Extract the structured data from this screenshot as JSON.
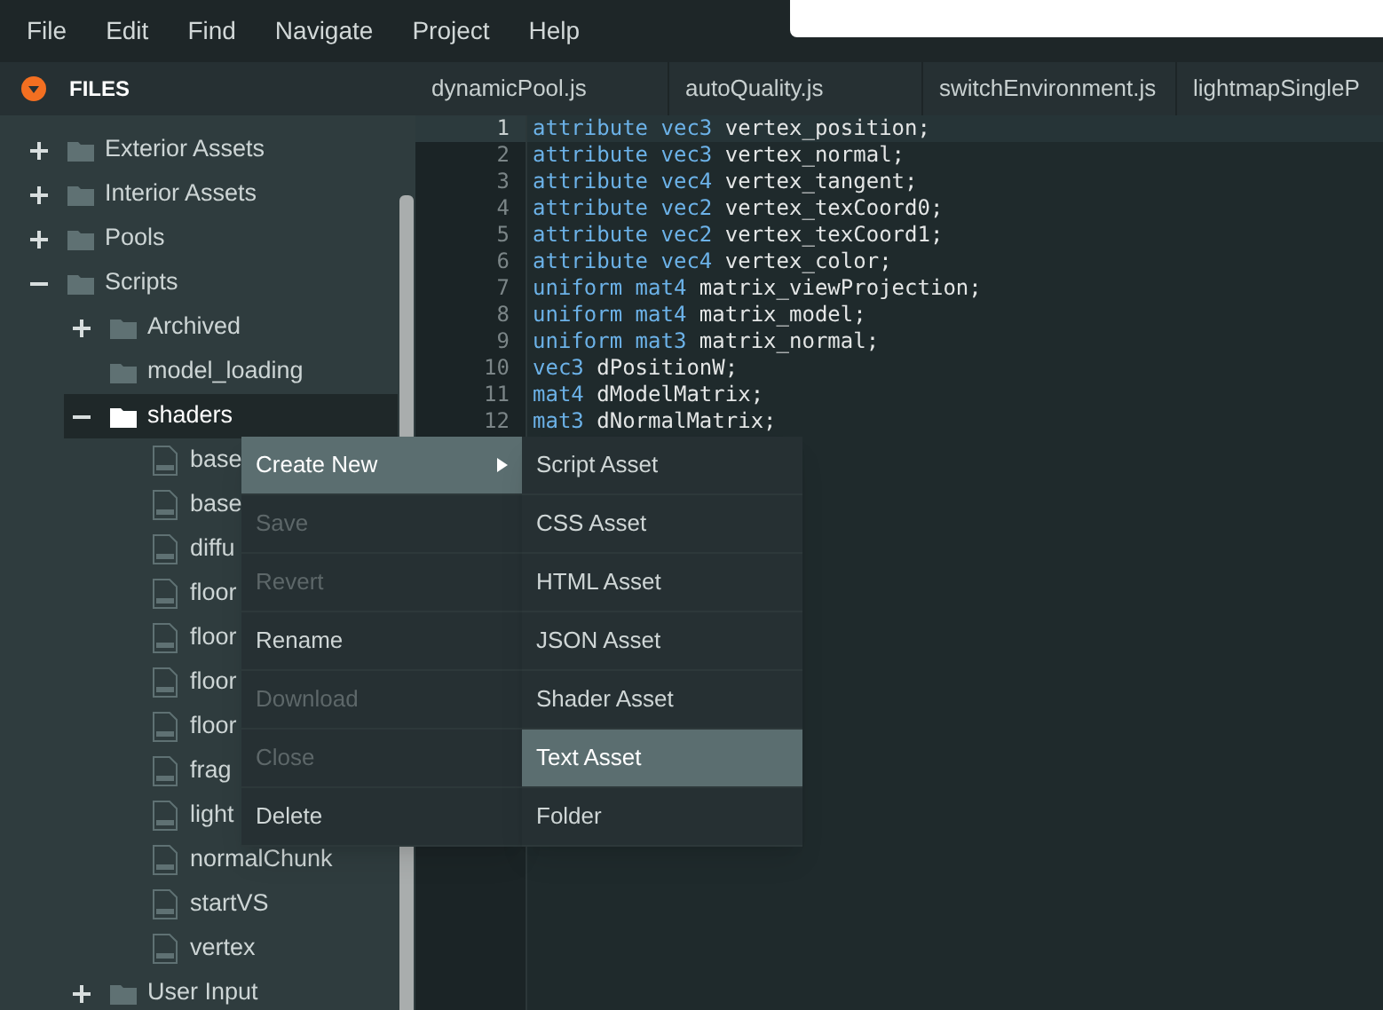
{
  "menu_bar": [
    "File",
    "Edit",
    "Find",
    "Navigate",
    "Project",
    "Help"
  ],
  "files_panel": {
    "title": "FILES",
    "tree": [
      {
        "name": "Exterior Assets",
        "kind": "folder",
        "expanded": false,
        "selected": false
      },
      {
        "name": "Interior Assets",
        "kind": "folder",
        "expanded": false,
        "selected": false
      },
      {
        "name": "Pools",
        "kind": "folder",
        "expanded": false,
        "selected": false
      },
      {
        "name": "Scripts",
        "kind": "folder",
        "expanded": true,
        "selected": false,
        "children": [
          {
            "name": "Archived",
            "kind": "folder",
            "expanded": false,
            "selected": false
          },
          {
            "name": "model_loading",
            "kind": "empty-folder",
            "selected": false
          },
          {
            "name": "shaders",
            "kind": "folder",
            "expanded": true,
            "selected": true,
            "children": [
              {
                "name": "base",
                "kind": "file",
                "selected": false
              },
              {
                "name": "base",
                "kind": "file",
                "selected": false
              },
              {
                "name": "diffu",
                "kind": "file",
                "selected": false
              },
              {
                "name": "floor",
                "kind": "file",
                "selected": false
              },
              {
                "name": "floor",
                "kind": "file",
                "selected": false
              },
              {
                "name": "floor",
                "kind": "file",
                "selected": false
              },
              {
                "name": "floor",
                "kind": "file",
                "selected": false
              },
              {
                "name": "frag",
                "kind": "file",
                "selected": false
              },
              {
                "name": "light",
                "kind": "file",
                "selected": false
              },
              {
                "name": "normalChunk",
                "kind": "file",
                "selected": false
              },
              {
                "name": "startVS",
                "kind": "file",
                "selected": false
              },
              {
                "name": "vertex",
                "kind": "file",
                "selected": false
              }
            ]
          },
          {
            "name": "User Input",
            "kind": "folder",
            "expanded": false,
            "selected": false
          }
        ]
      }
    ]
  },
  "tabs": [
    {
      "label": "dynamicPool.js"
    },
    {
      "label": "autoQuality.js"
    },
    {
      "label": "switchEnvironment.js"
    },
    {
      "label": "lightmapSingleP"
    }
  ],
  "editor": {
    "lines": [
      {
        "number": "1",
        "current": true,
        "tokens": [
          {
            "text": "attribute vec3",
            "kind": "keyword"
          },
          {
            "text": " vertex_position;",
            "kind": "plain"
          }
        ]
      },
      {
        "number": "2",
        "current": false,
        "tokens": [
          {
            "text": "attribute vec3",
            "kind": "keyword"
          },
          {
            "text": " vertex_normal;",
            "kind": "plain"
          }
        ]
      },
      {
        "number": "3",
        "current": false,
        "tokens": [
          {
            "text": "attribute vec4",
            "kind": "keyword"
          },
          {
            "text": " vertex_tangent;",
            "kind": "plain"
          }
        ]
      },
      {
        "number": "4",
        "current": false,
        "tokens": [
          {
            "text": "attribute vec2",
            "kind": "keyword"
          },
          {
            "text": " vertex_texCoord0;",
            "kind": "plain"
          }
        ]
      },
      {
        "number": "5",
        "current": false,
        "tokens": [
          {
            "text": "attribute vec2",
            "kind": "keyword"
          },
          {
            "text": " vertex_texCoord1;",
            "kind": "plain"
          }
        ]
      },
      {
        "number": "6",
        "current": false,
        "tokens": [
          {
            "text": "attribute vec4",
            "kind": "keyword"
          },
          {
            "text": " vertex_color;",
            "kind": "plain"
          }
        ]
      },
      {
        "number": "7",
        "current": false,
        "tokens": [
          {
            "text": "uniform mat4",
            "kind": "keyword"
          },
          {
            "text": " matrix_viewProjection;",
            "kind": "plain"
          }
        ]
      },
      {
        "number": "8",
        "current": false,
        "tokens": [
          {
            "text": "uniform mat4",
            "kind": "keyword"
          },
          {
            "text": " matrix_model;",
            "kind": "plain"
          }
        ]
      },
      {
        "number": "9",
        "current": false,
        "tokens": [
          {
            "text": "uniform mat3",
            "kind": "keyword"
          },
          {
            "text": " matrix_normal;",
            "kind": "plain"
          }
        ]
      },
      {
        "number": "10",
        "current": false,
        "tokens": [
          {
            "text": "vec3",
            "kind": "keyword"
          },
          {
            "text": " dPositionW;",
            "kind": "plain"
          }
        ]
      },
      {
        "number": "11",
        "current": false,
        "tokens": [
          {
            "text": "mat4",
            "kind": "keyword"
          },
          {
            "text": " dModelMatrix;",
            "kind": "plain"
          }
        ]
      },
      {
        "number": "12",
        "current": false,
        "tokens": [
          {
            "text": "mat3",
            "kind": "keyword"
          },
          {
            "text": " dNormalMatrix;",
            "kind": "plain"
          }
        ]
      }
    ]
  },
  "context_menu": {
    "items": [
      {
        "label": "Create New",
        "disabled": false,
        "selected": true,
        "submenu": true
      },
      {
        "label": "Save",
        "disabled": true,
        "selected": false,
        "submenu": false
      },
      {
        "label": "Revert",
        "disabled": true,
        "selected": false,
        "submenu": false
      },
      {
        "label": "Rename",
        "disabled": false,
        "selected": false,
        "submenu": false
      },
      {
        "label": "Download",
        "disabled": true,
        "selected": false,
        "submenu": false
      },
      {
        "label": "Close",
        "disabled": true,
        "selected": false,
        "submenu": false
      },
      {
        "label": "Delete",
        "disabled": false,
        "selected": false,
        "submenu": false
      }
    ]
  },
  "submenu": {
    "items": [
      {
        "label": "Script Asset",
        "selected": false
      },
      {
        "label": "CSS Asset",
        "selected": false
      },
      {
        "label": "HTML Asset",
        "selected": false
      },
      {
        "label": "JSON Asset",
        "selected": false
      },
      {
        "label": "Shader Asset",
        "selected": false
      },
      {
        "label": "Text Asset",
        "selected": true
      },
      {
        "label": "Folder",
        "selected": false
      }
    ]
  }
}
